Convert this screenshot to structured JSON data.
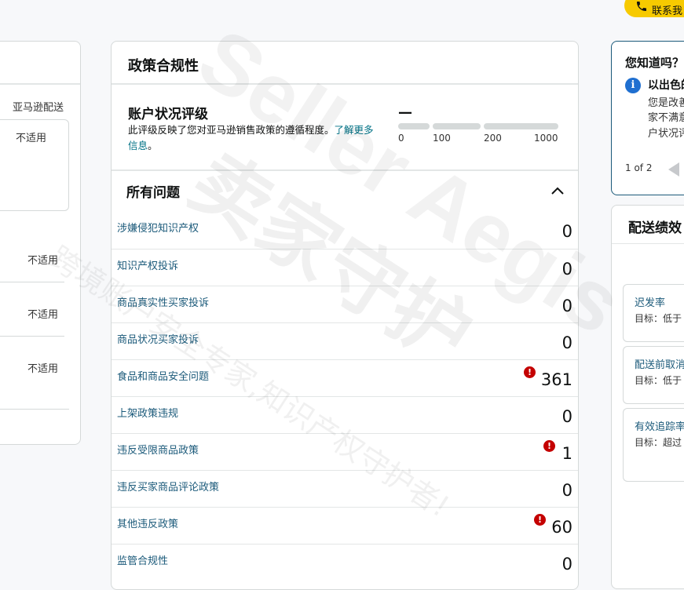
{
  "contact_button": {
    "label": "联系我"
  },
  "left_panel": {
    "column_header": "亚马逊配送",
    "values": [
      "不适用",
      "不适用",
      "不适用",
      "不适用"
    ]
  },
  "policy": {
    "title": "政策合规性",
    "health": {
      "title": "账户状况评级",
      "value": "—",
      "desc_prefix": "此评级反映了您对亚马逊销售政策的遵循程度。",
      "learn_more": "了解更多信息",
      "desc_suffix": "。",
      "scale_ticks": [
        "0",
        "100",
        "200",
        "1000"
      ]
    },
    "issues_title": "所有问题",
    "issues": [
      {
        "label": "涉嫌侵犯知识产权",
        "value": "0",
        "alert": false
      },
      {
        "label": "知识产权投诉",
        "value": "0",
        "alert": false
      },
      {
        "label": "商品真实性买家投诉",
        "value": "0",
        "alert": false
      },
      {
        "label": "商品状况买家投诉",
        "value": "0",
        "alert": false
      },
      {
        "label": "食品和商品安全问题",
        "value": "361",
        "alert": true
      },
      {
        "label": "上架政策违规",
        "value": "0",
        "alert": false
      },
      {
        "label": "违反受限商品政策",
        "value": "1",
        "alert": true
      },
      {
        "label": "违反买家商品评论政策",
        "value": "0",
        "alert": false
      },
      {
        "label": "其他违反政策",
        "value": "60",
        "alert": true
      },
      {
        "label": "监管合规性",
        "value": "0",
        "alert": false
      }
    ]
  },
  "did_you_know": {
    "title": "您知道吗？",
    "bold": "以出色的",
    "lines": [
      "您是改善",
      "家不满意",
      "户状况评"
    ],
    "pager": "1 of 2"
  },
  "shipping": {
    "title": "配送绩效",
    "metrics": [
      {
        "name": "迟发率",
        "target": "目标：低于"
      },
      {
        "name": "配送前取消",
        "target": "目标：低于"
      },
      {
        "name": "有效追踪率",
        "target": "目标：超过"
      }
    ]
  },
  "watermark": {
    "brand": "Seller Aegis",
    "cn": "卖家守护",
    "slogan": "跨境账户安全专家,知识产权守护者!"
  },
  "colors": {
    "accent": "#f7ca00",
    "link": "#1b5a7a",
    "alert": "#c40000",
    "info": "#1f6fd0"
  },
  "icons": [
    "phone-icon",
    "chevron-up-icon",
    "alert-icon",
    "info-icon",
    "triangle-left-icon"
  ]
}
